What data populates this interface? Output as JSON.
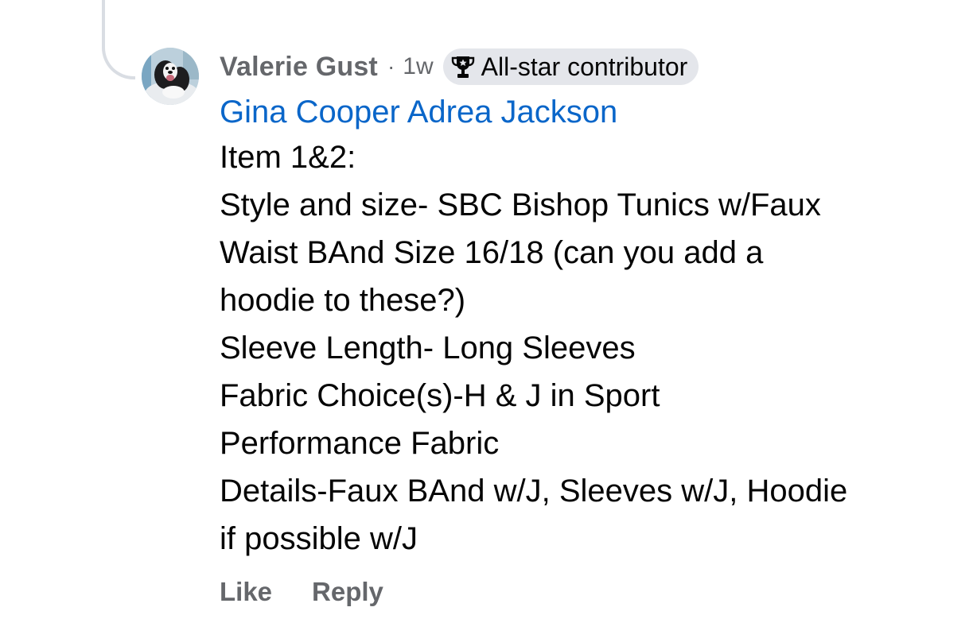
{
  "comment": {
    "author": "Valerie Gust",
    "separator": "·",
    "time": "1w",
    "badge": {
      "icon": "trophy-icon",
      "label": "All-star contributor"
    },
    "mentions": "Gina Cooper Adrea Jackson",
    "lines": [
      "Item 1&2:",
      "Style and size- SBC Bishop Tunics w/Faux",
      "Waist BAnd Size 16/18 (can you add a",
      "hoodie to these?)",
      "Sleeve Length- Long Sleeves",
      "Fabric Choice(s)-H & J in Sport",
      "Performance Fabric",
      "Details-Faux BAnd w/J, Sleeves w/J, Hoodie",
      "if possible w/J"
    ]
  },
  "actions": {
    "like_label": "Like",
    "reply_label": "Reply"
  },
  "colors": {
    "meta_gray": "#65676b",
    "mention_blue": "#0a66c9",
    "badge_bg": "#e4e6eb",
    "text": "#050505"
  }
}
